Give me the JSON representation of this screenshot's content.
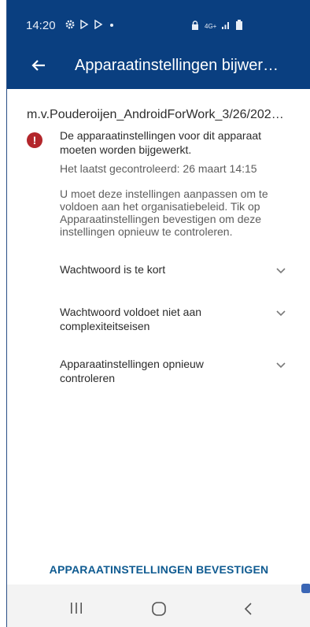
{
  "status_bar": {
    "time": "14:20",
    "network_type": "4G+",
    "icons": [
      "gear-icon",
      "play-icon",
      "play-icon",
      "dot-icon",
      "lock-icon",
      "signal-icon",
      "battery-icon"
    ]
  },
  "app_bar": {
    "title": "Apparaatinstellingen bijwer…"
  },
  "device": {
    "name": "m.v.Pouderoijen_AndroidForWork_3/26/202…"
  },
  "alert": {
    "message": "De apparaatinstellingen voor dit apparaat moeten worden bijgewerkt.",
    "last_checked": "Het laatst gecontroleerd: 26 maart 14:15",
    "instructions": "U moet deze instellingen aanpassen om te voldoen aan het organisatiebeleid. Tik op Apparaatinstellingen bevestigen om deze instellingen opnieuw te controleren."
  },
  "issues": [
    {
      "label": "Wachtwoord is te kort"
    },
    {
      "label": "Wachtwoord voldoet niet aan complexiteitseisen"
    },
    {
      "label": "Apparaatinstellingen opnieuw controleren"
    }
  ],
  "actions": {
    "confirm_label": "APPARAATINSTELLINGEN BEVESTIGEN"
  },
  "colors": {
    "primary": "#0a3f80",
    "alert": "#b3262b",
    "action_text": "#0f5b91"
  }
}
